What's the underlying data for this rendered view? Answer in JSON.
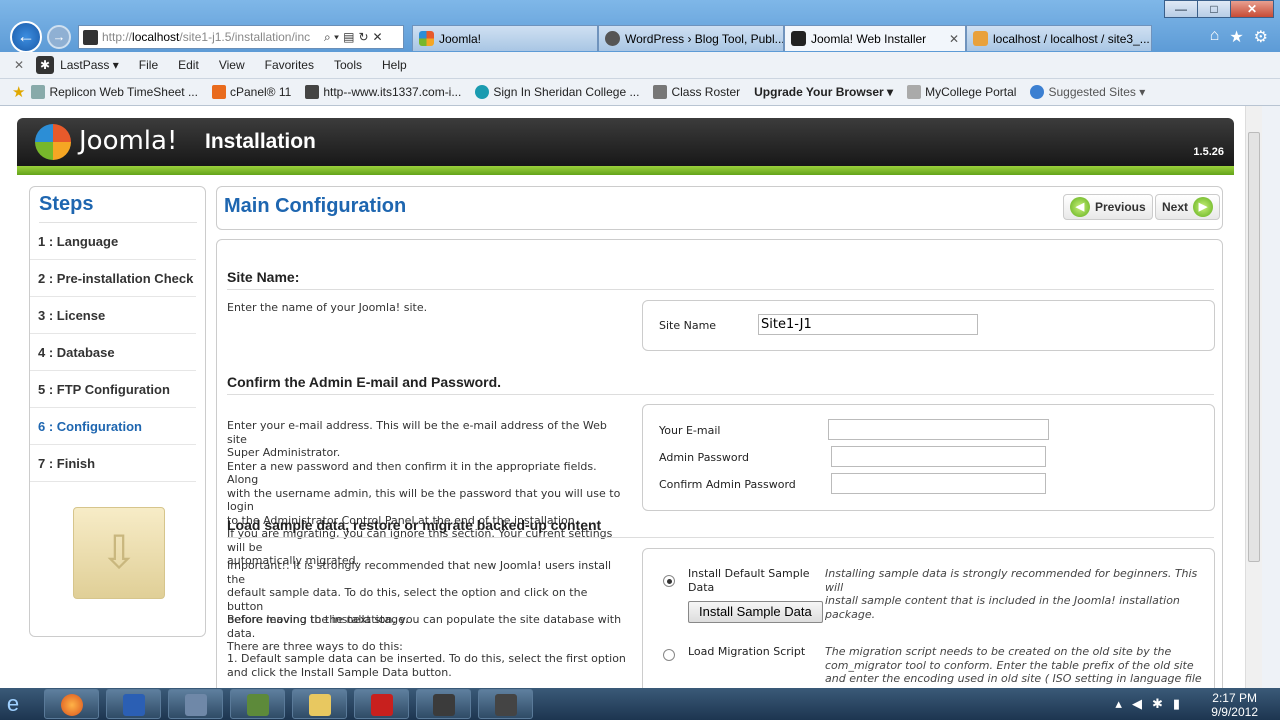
{
  "browser": {
    "address": {
      "prefix": "http://",
      "host": "localhost",
      "path": "/site1-j1.5/installation/inc"
    },
    "tabs": [
      {
        "label": "Joomla!",
        "active": false
      },
      {
        "label": "WordPress › Blog Tool, Publ...",
        "active": false
      },
      {
        "label": "Joomla! Web Installer",
        "active": true
      },
      {
        "label": "localhost / localhost / site3_...",
        "active": false
      }
    ],
    "menu": [
      "LastPass ▾",
      "File",
      "Edit",
      "View",
      "Favorites",
      "Tools",
      "Help"
    ],
    "favorites": [
      "Replicon Web TimeSheet ...",
      "cPanel® 11",
      "http--www.its1337.com-i...",
      "Sign In  Sheridan College ...",
      "Class Roster",
      "Upgrade Your Browser ▾",
      "MyCollege Portal",
      "Suggested Sites ▾"
    ]
  },
  "header": {
    "brand": "Joomla!",
    "title": "Installation",
    "version": "1.5.26"
  },
  "steps": {
    "title": "Steps",
    "items": [
      "1 : Language",
      "2 : Pre-installation Check",
      "3 : License",
      "4 : Database",
      "5 : FTP Configuration",
      "6 : Configuration",
      "7 : Finish"
    ],
    "current_index": 5
  },
  "main": {
    "title": "Main Configuration",
    "previous_label": "Previous",
    "next_label": "Next",
    "site": {
      "heading": "Site Name:",
      "desc": "Enter the name of your Joomla! site.",
      "label": "Site Name",
      "value": "Site1-J1"
    },
    "admin": {
      "heading": "Confirm the Admin E-mail and Password.",
      "desc_lines": [
        "Enter your e-mail address. This will be the e-mail address of the Web site",
        "Super Administrator.",
        "Enter a new password and then confirm it in the appropriate fields. Along",
        "with the username admin, this will be the password that you will use to login",
        "to the Administrator Control Panel at the end of the installation.",
        "If you are migrating, you can ignore this section. Your current settings will be",
        "automatically migrated."
      ],
      "email_label": "Your E-mail",
      "password_label": "Admin Password",
      "confirm_label": "Confirm Admin Password"
    },
    "sample": {
      "heading": "Load sample data, restore or migrate backed-up content",
      "important_lines": [
        "Important!: It is strongly recommended that new Joomla! users install the",
        "default sample data. To do this, select the option and click on the button",
        "before moving to the next stage."
      ],
      "before_lines": [
        "Before leaving the installation, you can populate the site database with data.",
        "There are three ways to do this:"
      ],
      "default_lines": [
        "1. Default sample data can be inserted. To do this, select the first option",
        "and click the Install Sample Data button."
      ],
      "opt1_label_1": "Install Default Sample",
      "opt1_label_2": "Data",
      "opt1_desc_lines": [
        "Installing sample data is strongly recommended for beginners. This will",
        "install sample content that is included in the Joomla! installation package."
      ],
      "install_button": "Install Sample Data",
      "opt2_label": "Load Migration Script",
      "opt2_desc_lines": [
        "The migration script needs to be created on the old site by the",
        "com_migrator tool to conform. Enter the table prefix of the old site",
        "and enter the encoding used in old site ( ISO setting in language file or"
      ]
    }
  },
  "taskbar": {
    "time": "2:17 PM",
    "date": "9/9/2012"
  },
  "colors": {
    "accent": "#1e66b0",
    "green": "#77b72b"
  }
}
